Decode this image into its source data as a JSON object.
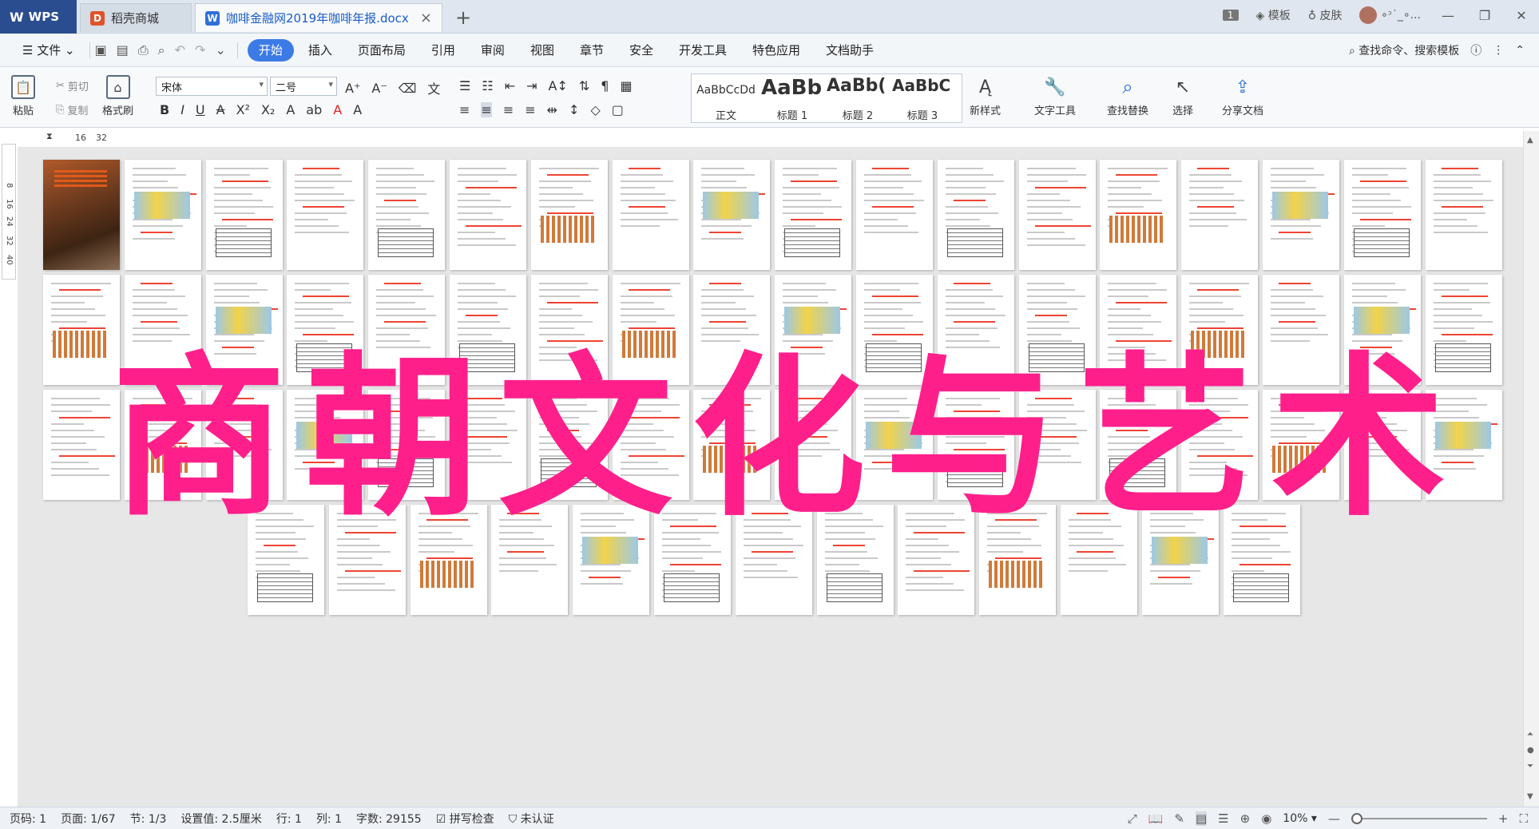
{
  "titlebar": {
    "wps_label": "WPS",
    "tabs": [
      {
        "label": "稻壳商城"
      },
      {
        "label": "咖啡金融网2019年咖啡年报.docx"
      }
    ],
    "right": {
      "badge": "1",
      "template_label": "模板",
      "skin_label": "皮肤",
      "user_label": "∘ᵓ˙_∘..."
    }
  },
  "menubar": {
    "file_label": "文件",
    "items": [
      "开始",
      "插入",
      "页面布局",
      "引用",
      "审阅",
      "视图",
      "章节",
      "安全",
      "开发工具",
      "特色应用",
      "文档助手"
    ],
    "active": "开始",
    "search_label": "查找命令、搜索模板"
  },
  "ribbon": {
    "paste_label": "粘贴",
    "cut_label": "剪切",
    "copy_label": "复制",
    "format_painter_label": "格式刷",
    "font_name": "宋体",
    "font_size": "二号",
    "styles": [
      {
        "sample": "AaBbCcDd",
        "label": "正文"
      },
      {
        "sample": "AaBb",
        "label": "标题 1"
      },
      {
        "sample": "AaBb(",
        "label": "标题 2"
      },
      {
        "sample": "AaBbC",
        "label": "标题 3"
      }
    ],
    "new_style_label": "新样式",
    "text_tools_label": "文字工具",
    "find_replace_label": "查找替换",
    "select_label": "选择",
    "share_label": "分享文档"
  },
  "ruler": {
    "h_ticks": [
      "16",
      "32"
    ],
    "v_ticks": [
      "8",
      "16",
      "24",
      "32",
      "40"
    ]
  },
  "watermark": "商朝文化与艺术",
  "statusbar": {
    "page_num": "页码: 1",
    "page_of": "页面: 1/67",
    "section": "节: 1/3",
    "setting": "设置值: 2.5厘米",
    "row": "行: 1",
    "col": "列: 1",
    "word_count": "字数: 29155",
    "spell_check": "拼写检查",
    "certify": "未认证",
    "zoom": "10%"
  }
}
